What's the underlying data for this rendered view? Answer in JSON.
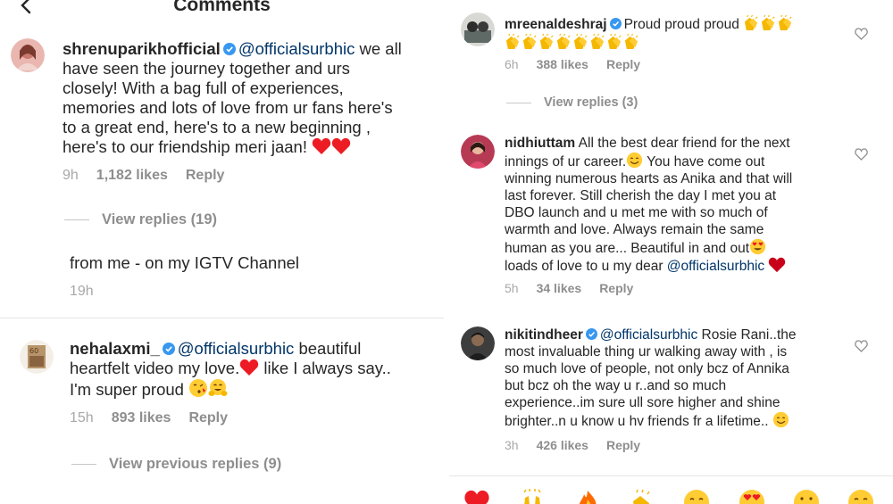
{
  "left": {
    "header": {
      "title": "Comments"
    },
    "comments": [
      {
        "username": "shrenuparikhofficial",
        "mention": "@officialsurbhic",
        "text_line1": " we all",
        "lines": [
          "have seen the journey together and urs",
          "closely! With a bag full of experiences,",
          "memories and lots of love from ur fans here's",
          "to a great end, here's to a new beginning ,",
          "here's to our friendship meri jaan!"
        ],
        "time": "9h",
        "likes": "1,182 likes",
        "reply": "Reply",
        "view_replies": "View replies (19)"
      },
      {
        "text": "from me - on my IGTV Channel",
        "time": "19h"
      },
      {
        "username": "nehalaxmi_",
        "mention": "@officialsurbhic",
        "text_line1": " beautiful",
        "line2": "heartfelt video my love.",
        "line2b": " like I always say..",
        "line3": "I'm super proud",
        "time": "15h",
        "likes": "893 likes",
        "reply": "Reply",
        "view_replies": "View previous replies (9)"
      }
    ]
  },
  "right": {
    "comments": [
      {
        "username": "mreenaldeshraj",
        "text": "Proud proud proud",
        "time": "6h",
        "likes": "388 likes",
        "reply": "Reply",
        "view_replies": "View replies (3)"
      },
      {
        "username": "nidhiuttam",
        "text_line1": " All the best dear friend for the next",
        "lines": [
          "innings of ur career.",
          " You have come out",
          "winning numerous hearts as Anika and that will",
          "last forever. Still cherish the day I met you at",
          "DBO launch and u met me with so much of",
          "warmth and love. Always remain the same",
          "human as you are... Beautiful in and out",
          "loads of love to u my dear "
        ],
        "mention": "@officialsurbhic",
        "time": "5h",
        "likes": "34 likes",
        "reply": "Reply"
      },
      {
        "username": "nikitindheer",
        "mention": "@officialsurbhic",
        "text_line1": " Rosie Rani..the",
        "lines": [
          "most invaluable thing ur walking away with , is",
          "so much love of people, not only bcz of Annika",
          "but bcz oh the way u r..and so much",
          "experience..im sure ull sore higher and shine",
          "brighter..n u know u hv friends fr a lifetime.."
        ],
        "time": "3h",
        "likes": "426 likes",
        "reply": "Reply"
      }
    ]
  },
  "colors": {
    "text": "#262626",
    "meta": "#8e8e8e",
    "mention": "#003569",
    "verified": "#3897f0",
    "heart_red": "#ed1c24"
  },
  "icons": [
    "back-arrow-icon",
    "verified-badge-icon",
    "heart-outline-icon",
    "red-heart-emoji",
    "clapping-hands-emoji",
    "smiling-face-emoji",
    "heart-eyes-emoji",
    "hugging-face-emoji",
    "kissing-face-emoji",
    "fire-emoji",
    "raising-hands-emoji"
  ]
}
